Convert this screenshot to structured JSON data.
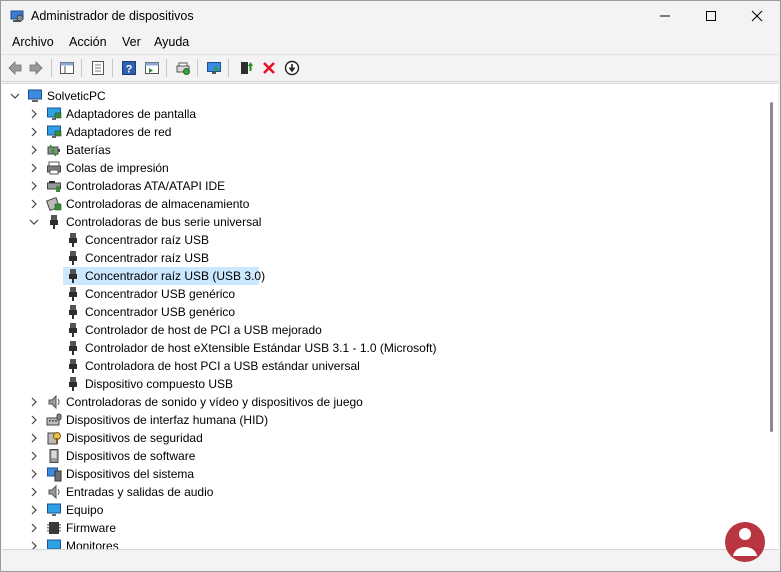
{
  "window": {
    "title": "Administrador de dispositivos"
  },
  "menu": [
    "Archivo",
    "Acción",
    "Ver",
    "Ayuda"
  ],
  "tree": {
    "root": "SolveticPC",
    "items": [
      {
        "label": "Adaptadores de pantalla",
        "icon": "display-adapter-icon",
        "expanded": false
      },
      {
        "label": "Adaptadores de red",
        "icon": "network-adapter-icon",
        "expanded": false
      },
      {
        "label": "Baterías",
        "icon": "battery-icon",
        "expanded": false
      },
      {
        "label": "Colas de impresión",
        "icon": "printer-icon",
        "expanded": false
      },
      {
        "label": "Controladoras ATA/ATAPI IDE",
        "icon": "ide-controller-icon",
        "expanded": false
      },
      {
        "label": "Controladoras de almacenamiento",
        "icon": "storage-controller-icon",
        "expanded": false
      },
      {
        "label": "Controladoras de bus serie universal",
        "icon": "usb-icon",
        "expanded": true,
        "children": [
          "Concentrador raíz USB",
          "Concentrador raíz USB",
          "Concentrador raíz USB (USB 3.0)",
          "Concentrador USB genérico",
          "Concentrador USB genérico",
          "Controlador de host de PCI a USB mejorado",
          "Controlador de host eXtensible Estándar USB 3.1 - 1.0 (Microsoft)",
          "Controladora de host PCI a USB estándar universal",
          "Dispositivo compuesto USB"
        ],
        "selected_child": 2
      },
      {
        "label": "Controladoras de sonido y vídeo y dispositivos de juego",
        "icon": "speaker-icon",
        "expanded": false
      },
      {
        "label": "Dispositivos de interfaz humana (HID)",
        "icon": "hid-icon",
        "expanded": false
      },
      {
        "label": "Dispositivos de seguridad",
        "icon": "security-device-icon",
        "expanded": false
      },
      {
        "label": "Dispositivos de software",
        "icon": "software-device-icon",
        "expanded": false
      },
      {
        "label": "Dispositivos del sistema",
        "icon": "system-device-icon",
        "expanded": false
      },
      {
        "label": "Entradas y salidas de audio",
        "icon": "speaker-icon",
        "expanded": false
      },
      {
        "label": "Equipo",
        "icon": "monitor-icon",
        "expanded": false
      },
      {
        "label": "Firmware",
        "icon": "firmware-icon",
        "expanded": false
      },
      {
        "label": "Monitores",
        "icon": "monitor-icon",
        "expanded": false
      }
    ]
  },
  "colors": {
    "selection": "#cce8ff",
    "accent_red": "#e81123",
    "accent_green": "#1a8f1a"
  }
}
